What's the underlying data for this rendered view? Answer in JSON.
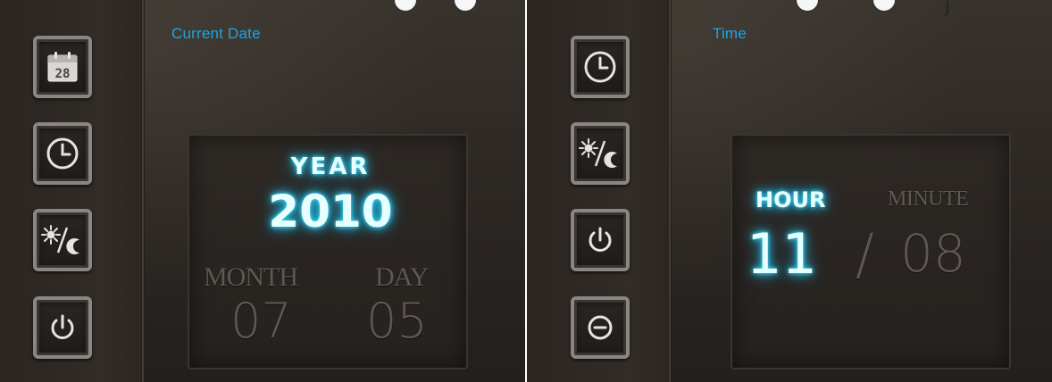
{
  "date_screen": {
    "title": "Current Date",
    "year_label": "YEAR",
    "year_value": "2010",
    "month_label": "MONTH",
    "month_value": "07",
    "day_label": "DAY",
    "day_value": "05",
    "calendar_icon_day": "28",
    "sidebar": [
      {
        "icon": "calendar-icon"
      },
      {
        "icon": "clock-icon"
      },
      {
        "icon": "sun-moon-icon"
      },
      {
        "icon": "power-icon"
      }
    ]
  },
  "time_screen": {
    "title": "Time",
    "hour_label": "HOUR",
    "hour_value": "11",
    "separator": "/",
    "minute_label": "MINUTE",
    "minute_value": "08",
    "sidebar": [
      {
        "icon": "clock-icon"
      },
      {
        "icon": "sun-moon-icon"
      },
      {
        "icon": "power-icon"
      },
      {
        "icon": "minus-circle-icon"
      }
    ]
  },
  "colors": {
    "accent": "#1aa7e0",
    "glow": "#40e0ff",
    "dim_text": "#5f5852",
    "background": "#2d2824"
  }
}
